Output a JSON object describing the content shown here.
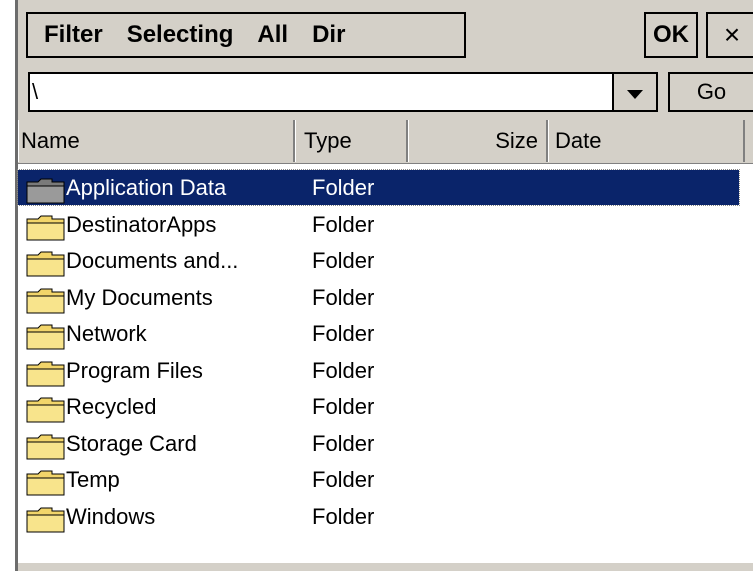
{
  "menu": {
    "items": [
      "Filter",
      "Selecting",
      "All",
      "Dir"
    ],
    "ok_label": "OK",
    "close_label": "×"
  },
  "address": {
    "value": "\\",
    "go_label": "Go"
  },
  "columns": {
    "name": "Name",
    "type": "Type",
    "size": "Size",
    "date": "Date"
  },
  "files": [
    {
      "name": "Application Data",
      "type": "Folder",
      "selected": true
    },
    {
      "name": "DestinatorApps",
      "type": "Folder",
      "selected": false
    },
    {
      "name": "Documents and...",
      "type": "Folder",
      "selected": false
    },
    {
      "name": "My Documents",
      "type": "Folder",
      "selected": false
    },
    {
      "name": "Network",
      "type": "Folder",
      "selected": false
    },
    {
      "name": "Program Files",
      "type": "Folder",
      "selected": false
    },
    {
      "name": "Recycled",
      "type": "Folder",
      "selected": false
    },
    {
      "name": "Storage Card",
      "type": "Folder",
      "selected": false
    },
    {
      "name": "Temp",
      "type": "Folder",
      "selected": false
    },
    {
      "name": "Windows",
      "type": "Folder",
      "selected": false
    }
  ],
  "colors": {
    "selection": "#0a246a",
    "chrome": "#d4d0c8",
    "folder": "#f2d56a"
  },
  "icons": {
    "folder": "folder-icon",
    "dropdown": "chevron-down-icon",
    "close": "close-icon"
  }
}
